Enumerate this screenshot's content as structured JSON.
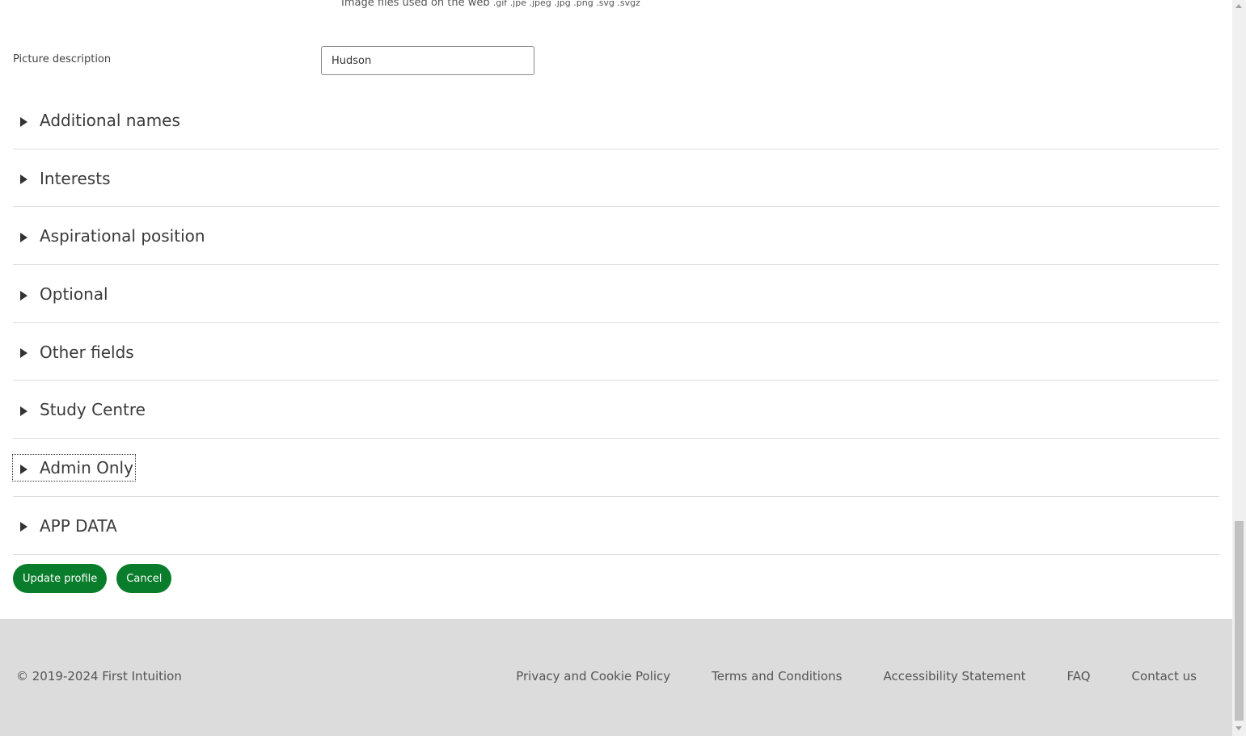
{
  "picture": {
    "filetypes_text": "Image files used on the web",
    "filetypes_ext": ".gif .jpe .jpeg .jpg .png .svg .svgz",
    "description_label": "Picture description",
    "description_value": "Hudson"
  },
  "sections": [
    {
      "title": "Additional names"
    },
    {
      "title": "Interests"
    },
    {
      "title": "Aspirational position"
    },
    {
      "title": "Optional"
    },
    {
      "title": "Other fields"
    },
    {
      "title": "Study Centre"
    },
    {
      "title": "Admin Only"
    },
    {
      "title": "APP DATA"
    }
  ],
  "actions": {
    "update_label": "Update profile",
    "cancel_label": "Cancel"
  },
  "footer": {
    "copyright": "© 2019-2024 First Intuition",
    "links": [
      "Privacy and Cookie Policy",
      "Terms and Conditions",
      "Accessibility Statement",
      "FAQ",
      "Contact us"
    ]
  },
  "colors": {
    "button_bg": "#0a7d2c",
    "footer_bg": "#dcdcdc"
  }
}
